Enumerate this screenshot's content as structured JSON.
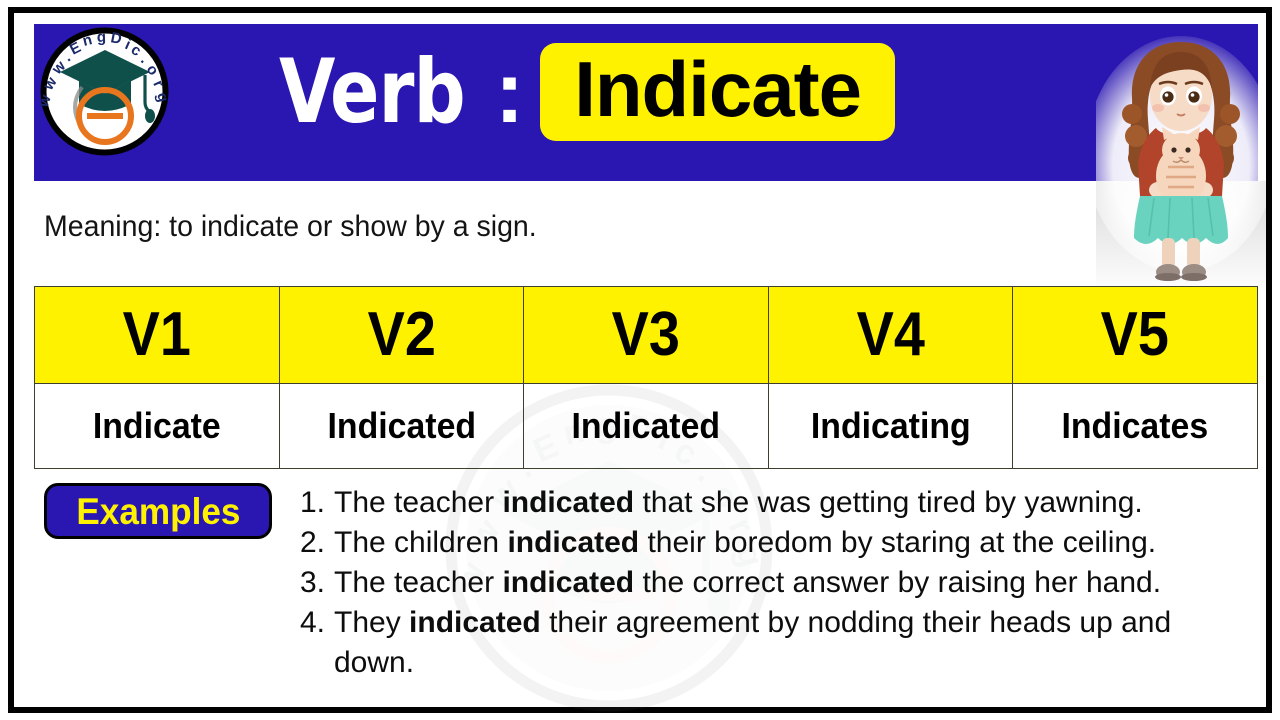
{
  "frame": {
    "border_color": "#000000",
    "background": "#ffffff"
  },
  "header": {
    "background_color": "#2A16B0",
    "label": "Verb",
    "separator": ":",
    "word": "Indicate",
    "word_chip_color": "#FFF200",
    "word_text_color": "#000000",
    "logo": {
      "name": "engdic-logo",
      "text": "www.EngDic.org",
      "letter": "e",
      "cap_color": "#0f4b46",
      "letter_color": "#E8761E",
      "circle_color": "#ffffff",
      "ring_color": "#000000",
      "text_color": "#1b2a6b"
    },
    "illustration": {
      "name": "girl-holding-cat",
      "hair_color": "#8a4b25",
      "shirt_color": "#b2442b",
      "skirt_color": "#6ad3c0",
      "cat_color": "#f0c9a8",
      "skin_color": "#f3d7c2",
      "shoe_color": "#9b8c84"
    }
  },
  "meaning": {
    "prefix": "Meaning:",
    "text": "Meaning: to indicate or show by a sign."
  },
  "table": {
    "header_bg": "#FFF200",
    "border_color": "#3f3f2e",
    "headers": [
      "V1",
      "V2",
      "V3",
      "V4",
      "V5"
    ],
    "forms": [
      "Indicate",
      "Indicated",
      "Indicated",
      "Indicating",
      "Indicates"
    ]
  },
  "examples": {
    "badge_label": "Examples",
    "badge_bg": "#2A16B0",
    "badge_text_color": "#FFF200",
    "items": [
      {
        "number": "1.",
        "before": "The teacher ",
        "bold": "indicated",
        "after": " that she was getting tired by yawning."
      },
      {
        "number": "2.",
        "before": "The children ",
        "bold": "indicated",
        "after": " their boredom by staring at the ceiling."
      },
      {
        "number": "3.",
        "before": "The teacher ",
        "bold": "indicated",
        "after": " the correct answer by raising her hand."
      },
      {
        "number": "4.",
        "before": "They ",
        "bold": "indicated",
        "after": " their agreement by nodding their heads up and down."
      }
    ]
  },
  "watermark": {
    "name": "engdic-watermark",
    "text": "www.EngDic.org",
    "letter": "e"
  }
}
